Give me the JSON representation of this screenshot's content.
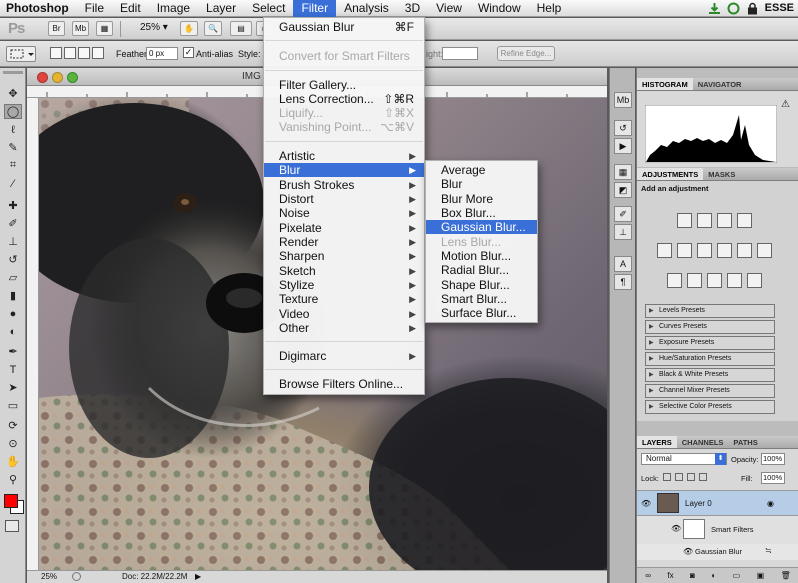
{
  "menubar": {
    "app": "Photoshop",
    "items": [
      "File",
      "Edit",
      "Image",
      "Layer",
      "Select",
      "Filter",
      "Analysis",
      "3D",
      "View",
      "Window",
      "Help"
    ],
    "active": "Filter",
    "right_text": "ESSE"
  },
  "appbar": {
    "logo": "Ps",
    "buttons": [
      "Br",
      "Mb"
    ],
    "zoom": "25%"
  },
  "options": {
    "feather_label": "Feather:",
    "feather_value": "0 px",
    "antialias_label": "Anti-alias",
    "style_label": "Style:",
    "height_label": "ight:",
    "refine_edge": "Refine Edge..."
  },
  "document": {
    "tab_title": "IMG",
    "zoom_status": "25%",
    "doc_status": "Doc: 22.2M/22.2M"
  },
  "filter_menu": {
    "items": [
      {
        "label": "Gaussian Blur",
        "shortcut": "⌘F",
        "disabled": false
      },
      {
        "label": "Convert for Smart Filters",
        "disabled": true
      },
      {
        "label": "Filter Gallery...",
        "disabled": false
      },
      {
        "label": "Lens Correction...",
        "shortcut": "⇧⌘R",
        "disabled": false
      },
      {
        "label": "Liquify...",
        "shortcut": "⇧⌘X",
        "disabled": true
      },
      {
        "label": "Vanishing Point...",
        "shortcut": "⌥⌘V",
        "disabled": true
      },
      {
        "label": "Artistic",
        "submenu": true
      },
      {
        "label": "Blur",
        "submenu": true,
        "highlighted": true
      },
      {
        "label": "Brush Strokes",
        "submenu": true
      },
      {
        "label": "Distort",
        "submenu": true
      },
      {
        "label": "Noise",
        "submenu": true
      },
      {
        "label": "Pixelate",
        "submenu": true
      },
      {
        "label": "Render",
        "submenu": true
      },
      {
        "label": "Sharpen",
        "submenu": true
      },
      {
        "label": "Sketch",
        "submenu": true
      },
      {
        "label": "Stylize",
        "submenu": true
      },
      {
        "label": "Texture",
        "submenu": true
      },
      {
        "label": "Video",
        "submenu": true
      },
      {
        "label": "Other",
        "submenu": true
      },
      {
        "label": "Digimarc",
        "submenu": true
      },
      {
        "label": "Browse Filters Online..."
      }
    ]
  },
  "blur_menu": {
    "items": [
      {
        "label": "Average"
      },
      {
        "label": "Blur"
      },
      {
        "label": "Blur More"
      },
      {
        "label": "Box Blur..."
      },
      {
        "label": "Gaussian Blur...",
        "highlighted": true
      },
      {
        "label": "Lens Blur...",
        "disabled": true
      },
      {
        "label": "Motion Blur..."
      },
      {
        "label": "Radial Blur..."
      },
      {
        "label": "Shape Blur..."
      },
      {
        "label": "Smart Blur..."
      },
      {
        "label": "Surface Blur..."
      }
    ]
  },
  "panels": {
    "histogram_tabs": [
      "HISTOGRAM",
      "NAVIGATOR"
    ],
    "adjustments_tabs": [
      "ADJUSTMENTS",
      "MASKS"
    ],
    "add_adjustment": "Add an adjustment",
    "presets": [
      "Levels Presets",
      "Curves Presets",
      "Exposure Presets",
      "Hue/Saturation Presets",
      "Black & White Presets",
      "Channel Mixer Presets",
      "Selective Color Presets"
    ],
    "layers_tabs": [
      "LAYERS",
      "CHANNELS",
      "PATHS"
    ],
    "blend_mode": "Normal",
    "opacity_label": "Opacity:",
    "opacity_value": "100%",
    "lock_label": "Lock:",
    "fill_label": "Fill:",
    "fill_value": "100%",
    "layer_name": "Layer 0",
    "smart_filters_label": "Smart Filters",
    "gaussian_blur_label": "Gaussian Blur"
  },
  "colors": {
    "menu_highlight": "#3a6fd8",
    "foreground_color": "#ff0000",
    "background_color": "#ffffff"
  }
}
